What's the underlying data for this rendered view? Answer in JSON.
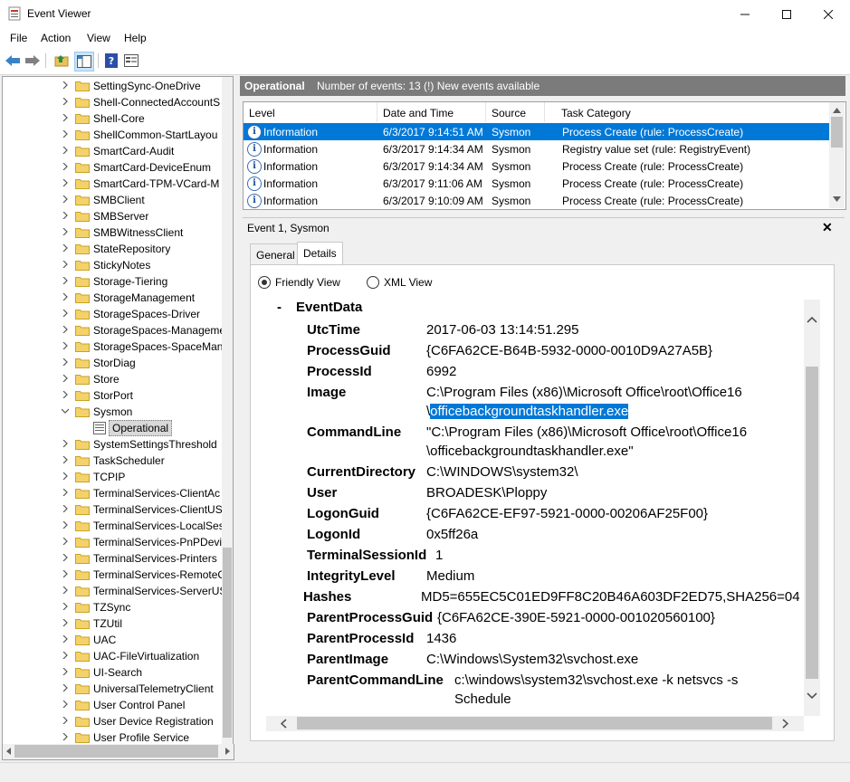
{
  "window": {
    "title": "Event Viewer"
  },
  "menu": [
    "File",
    "Action",
    "View",
    "Help"
  ],
  "tree": {
    "items": [
      {
        "label": "SettingSync-OneDrive",
        "expanded": false
      },
      {
        "label": "Shell-ConnectedAccountS",
        "expanded": false
      },
      {
        "label": "Shell-Core",
        "expanded": false
      },
      {
        "label": "ShellCommon-StartLayou",
        "expanded": false
      },
      {
        "label": "SmartCard-Audit",
        "expanded": false
      },
      {
        "label": "SmartCard-DeviceEnum",
        "expanded": false
      },
      {
        "label": "SmartCard-TPM-VCard-M",
        "expanded": false
      },
      {
        "label": "SMBClient",
        "expanded": false
      },
      {
        "label": "SMBServer",
        "expanded": false
      },
      {
        "label": "SMBWitnessClient",
        "expanded": false
      },
      {
        "label": "StateRepository",
        "expanded": false
      },
      {
        "label": "StickyNotes",
        "expanded": false
      },
      {
        "label": "Storage-Tiering",
        "expanded": false
      },
      {
        "label": "StorageManagement",
        "expanded": false
      },
      {
        "label": "StorageSpaces-Driver",
        "expanded": false
      },
      {
        "label": "StorageSpaces-Manageme",
        "expanded": false
      },
      {
        "label": "StorageSpaces-SpaceMana",
        "expanded": false
      },
      {
        "label": "StorDiag",
        "expanded": false
      },
      {
        "label": "Store",
        "expanded": false
      },
      {
        "label": "StorPort",
        "expanded": false
      },
      {
        "label": "Sysmon",
        "expanded": true
      },
      {
        "label": "Operational",
        "child": true
      },
      {
        "label": "SystemSettingsThreshold",
        "expanded": false
      },
      {
        "label": "TaskScheduler",
        "expanded": false
      },
      {
        "label": "TCPIP",
        "expanded": false
      },
      {
        "label": "TerminalServices-ClientAc",
        "expanded": false
      },
      {
        "label": "TerminalServices-ClientUS",
        "expanded": false
      },
      {
        "label": "TerminalServices-LocalSes",
        "expanded": false
      },
      {
        "label": "TerminalServices-PnPDevi",
        "expanded": false
      },
      {
        "label": "TerminalServices-Printers",
        "expanded": false
      },
      {
        "label": "TerminalServices-RemoteC",
        "expanded": false
      },
      {
        "label": "TerminalServices-ServerUS",
        "expanded": false
      },
      {
        "label": "TZSync",
        "expanded": false
      },
      {
        "label": "TZUtil",
        "expanded": false
      },
      {
        "label": "UAC",
        "expanded": false
      },
      {
        "label": "UAC-FileVirtualization",
        "expanded": false
      },
      {
        "label": "UI-Search",
        "expanded": false
      },
      {
        "label": "UniversalTelemetryClient",
        "expanded": false
      },
      {
        "label": "User Control Panel",
        "expanded": false
      },
      {
        "label": "User Device Registration",
        "expanded": false
      },
      {
        "label": "User Profile Service",
        "expanded": false
      }
    ]
  },
  "log_header": {
    "name": "Operational",
    "info": "Number of events: 13 (!) New events available"
  },
  "event_list": {
    "columns": [
      "Level",
      "Date and Time",
      "Source",
      "Task Category"
    ],
    "rows": [
      [
        "Information",
        "6/3/2017 9:14:51 AM",
        "Sysmon",
        "Process Create (rule: ProcessCreate)"
      ],
      [
        "Information",
        "6/3/2017 9:14:34 AM",
        "Sysmon",
        "Registry value set (rule: RegistryEvent)"
      ],
      [
        "Information",
        "6/3/2017 9:14:34 AM",
        "Sysmon",
        "Process Create (rule: ProcessCreate)"
      ],
      [
        "Information",
        "6/3/2017 9:11:06 AM",
        "Sysmon",
        "Process Create (rule: ProcessCreate)"
      ],
      [
        "Information",
        "6/3/2017 9:10:09 AM",
        "Sysmon",
        "Process Create (rule: ProcessCreate)"
      ]
    ]
  },
  "details": {
    "title": "Event 1, Sysmon",
    "close_glyph": "✕",
    "tabs": [
      "General",
      "Details"
    ],
    "friendly_view": "Friendly View",
    "xml_view": "XML View",
    "section_toggle": "-",
    "section_name": "EventData",
    "fields": [
      {
        "name": "UtcTime",
        "value": "2017-06-03 13:14:51.295"
      },
      {
        "name": "ProcessGuid",
        "value": "{C6FA62CE-B64B-5932-0000-0010D9A27A5B}"
      },
      {
        "name": "ProcessId",
        "value": "6992"
      },
      {
        "name": "Image",
        "value": "C:\\Program Files (x86)\\Microsoft Office\\root\\Office16",
        "value2": "\\",
        "value2_selected": "officebackgroundtaskhandler.exe"
      },
      {
        "name": "CommandLine",
        "value": "\"C:\\Program Files (x86)\\Microsoft Office\\root\\Office16",
        "value2": "\\officebackgroundtaskhandler.exe\""
      },
      {
        "name": "CurrentDirectory",
        "value": "C:\\WINDOWS\\system32\\"
      },
      {
        "name": "User",
        "value": "BROADESK\\Ploppy"
      },
      {
        "name": "LogonGuid",
        "value": "{C6FA62CE-EF97-5921-0000-00206AF25F00}"
      },
      {
        "name": "LogonId",
        "value": "0x5ff26a"
      },
      {
        "name": "TerminalSessionId",
        "value": "1"
      },
      {
        "name": "IntegrityLevel",
        "value": "Medium"
      },
      {
        "name": "Hashes",
        "value": "MD5=655EC5C01ED9FF8C20B46A603DF2ED75,SHA256=04"
      },
      {
        "name": "ParentProcessGuid",
        "value": "{C6FA62CE-390E-5921-0000-001020560100}"
      },
      {
        "name": "ParentProcessId",
        "value": "1436"
      },
      {
        "name": "ParentImage",
        "value": "C:\\Windows\\System32\\svchost.exe"
      },
      {
        "name": "ParentCommandLine",
        "value": "c:\\windows\\system32\\svchost.exe -k netsvcs -s",
        "value2": "Schedule"
      }
    ]
  },
  "colors": {
    "selection": "#0078d7",
    "header_bg": "#7b7b7b"
  },
  "icons": [
    "event-viewer-app-icon",
    "back-arrow-icon",
    "forward-arrow-icon",
    "up-folder-icon",
    "show-hide-tree-icon",
    "help-icon",
    "properties-icon",
    "folder-icon",
    "info-icon",
    "chevron-right-icon",
    "chevron-down-icon"
  ]
}
